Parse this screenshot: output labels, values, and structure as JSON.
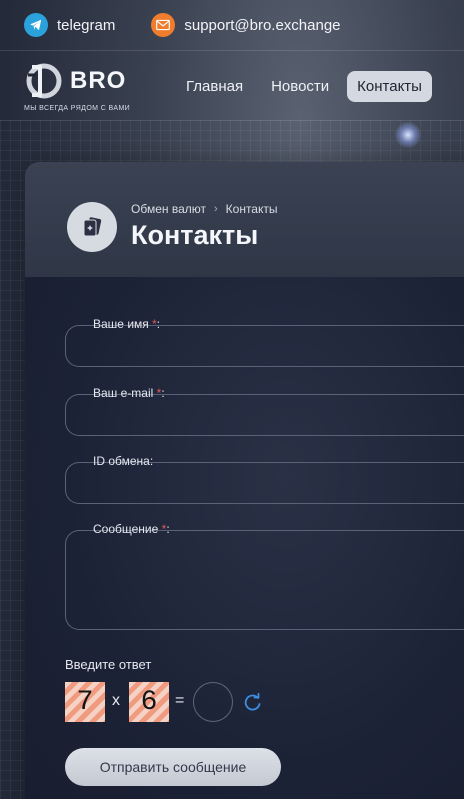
{
  "topbar": {
    "telegram_label": "telegram",
    "email_label": "support@bro.exchange"
  },
  "header": {
    "logo_text": "BRO",
    "tagline": "МЫ ВСЕГДА РЯДОМ С ВАМИ",
    "nav": [
      {
        "label": "Главная",
        "active": false
      },
      {
        "label": "Новости",
        "active": false
      },
      {
        "label": "Контакты",
        "active": true
      }
    ]
  },
  "page": {
    "breadcrumb": [
      "Обмен валют",
      "Контакты"
    ],
    "title": "Контакты"
  },
  "form": {
    "fields": [
      {
        "label": "Ваше имя",
        "required": true
      },
      {
        "label": "Ваш e-mail",
        "required": true
      },
      {
        "label": "ID обмена:",
        "required": false
      },
      {
        "label": "Сообщение",
        "required": true
      }
    ],
    "required_mark": "*",
    "required_suffix": ":",
    "captcha": {
      "title": "Введите ответ",
      "a": "7",
      "op": "x",
      "b": "6",
      "eq": "="
    },
    "submit_label": "Отправить сообщение"
  },
  "colors": {
    "telegram": "#2aa3dd",
    "email": "#f07d2d",
    "accent_refresh": "#3d8ee0",
    "required": "#e05a5a"
  },
  "icons": {
    "telegram": "telegram-icon",
    "email": "envelope-icon",
    "page": "cards-icon",
    "refresh": "refresh-icon"
  }
}
